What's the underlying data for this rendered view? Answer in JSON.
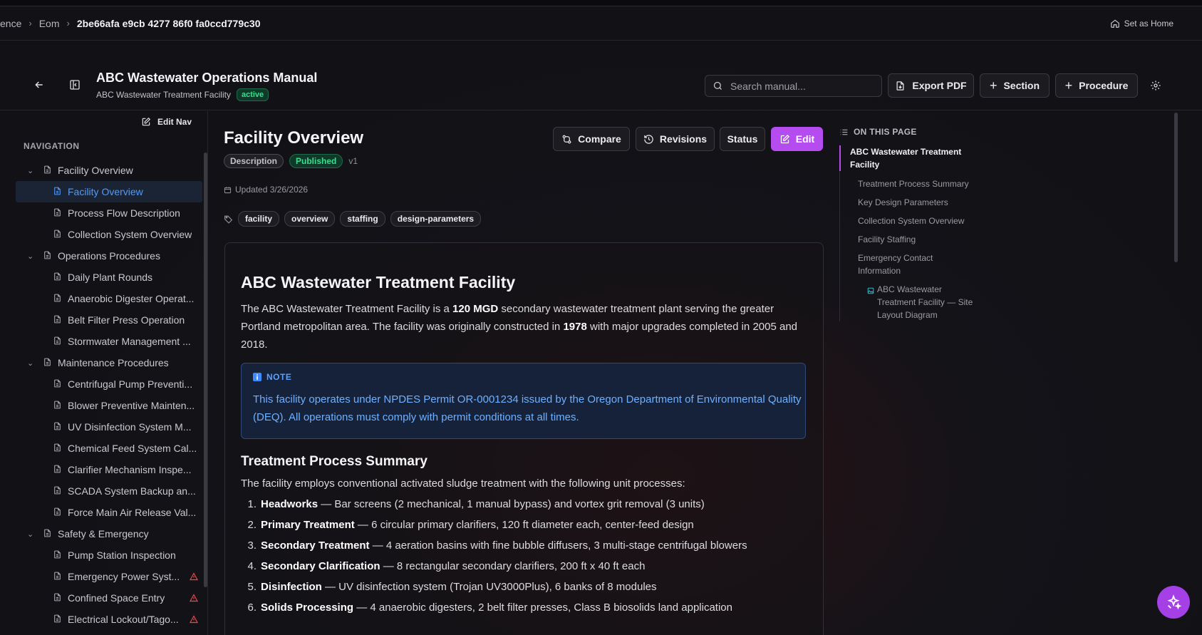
{
  "breadcrumb": {
    "items": [
      "ence",
      "Eom",
      "2be66afa e9cb 4277 86f0 fa0ccd779c30"
    ]
  },
  "header": {
    "set_home_label": "Set as Home",
    "title": "ABC Wastewater Operations Manual",
    "subtitle": "ABC Wastewater Treatment Facility",
    "status_badge": "active",
    "search_placeholder": "Search manual...",
    "export_label": "Export PDF",
    "section_label": "Section",
    "procedure_label": "Procedure"
  },
  "sidebar": {
    "edit_nav_label": "Edit Nav",
    "heading": "NAVIGATION",
    "groups": [
      {
        "label": "Facility Overview",
        "items": [
          {
            "label": "Facility Overview",
            "selected": true
          },
          {
            "label": "Process Flow Description"
          },
          {
            "label": "Collection System Overview"
          }
        ]
      },
      {
        "label": "Operations Procedures",
        "items": [
          {
            "label": "Daily Plant Rounds"
          },
          {
            "label": "Anaerobic Digester Operat..."
          },
          {
            "label": "Belt Filter Press Operation"
          },
          {
            "label": "Stormwater Management ..."
          }
        ]
      },
      {
        "label": "Maintenance Procedures",
        "items": [
          {
            "label": "Centrifugal Pump Preventi..."
          },
          {
            "label": "Blower Preventive Mainten..."
          },
          {
            "label": "UV Disinfection System M..."
          },
          {
            "label": "Chemical Feed System Cal..."
          },
          {
            "label": "Clarifier Mechanism Inspe..."
          },
          {
            "label": "SCADA System Backup an..."
          },
          {
            "label": "Force Main Air Release Val..."
          }
        ]
      },
      {
        "label": "Safety & Emergency",
        "items": [
          {
            "label": "Pump Station Inspection"
          },
          {
            "label": "Emergency Power Syst...",
            "warning": true
          },
          {
            "label": "Confined Space Entry",
            "warning": true
          },
          {
            "label": "Electrical Lockout/Tago...",
            "warning": true
          }
        ]
      }
    ]
  },
  "page": {
    "title": "Facility Overview",
    "type_pill": "Description",
    "status_pill": "Published",
    "version": "v1",
    "updated": "Updated 3/26/2026",
    "tags": [
      "facility",
      "overview",
      "staffing",
      "design-parameters"
    ],
    "actions": {
      "compare": "Compare",
      "revisions": "Revisions",
      "status": "Status",
      "edit": "Edit"
    }
  },
  "content": {
    "h1": "ABC Wastewater Treatment Facility",
    "para": {
      "t1": "The ABC Wastewater Treatment Facility is a ",
      "b1": "120 MGD",
      "t2": " secondary wastewater treatment plant serving the greater Portland metropolitan area. The facility was originally constructed in ",
      "b2": "1978",
      "t3": " with major upgrades completed in 2005 and 2018."
    },
    "note": {
      "label": "NOTE",
      "body": "This facility operates under NPDES Permit OR-0001234 issued by the Oregon Department of Environmental Quality (DEQ). All operations must comply with permit conditions at all times."
    },
    "h2": "Treatment Process Summary",
    "intro": "The facility employs conventional activated sludge treatment with the following unit processes:",
    "list": [
      {
        "num": "1.",
        "term": "Headworks",
        "desc": " — Bar screens (2 mechanical, 1 manual bypass) and vortex grit removal (3 units)"
      },
      {
        "num": "2.",
        "term": "Primary Treatment",
        "desc": " — 6 circular primary clarifiers, 120 ft diameter each, center-feed design"
      },
      {
        "num": "3.",
        "term": "Secondary Treatment",
        "desc": " — 4 aeration basins with fine bubble diffusers, 3 multi-stage centrifugal blowers"
      },
      {
        "num": "4.",
        "term": "Secondary Clarification",
        "desc": " — 8 rectangular secondary clarifiers, 200 ft x 40 ft each"
      },
      {
        "num": "5.",
        "term": "Disinfection",
        "desc": " — UV disinfection system (Trojan UV3000Plus), 6 banks of 8 modules"
      },
      {
        "num": "6.",
        "term": "Solids Processing",
        "desc": " — 4 anaerobic digesters, 2 belt filter presses, Class B biosolids land application"
      }
    ]
  },
  "toc": {
    "heading": "ON THIS PAGE",
    "items": [
      {
        "label": "ABC Wastewater Treatment Facility",
        "active": true
      },
      {
        "label": "Treatment Process Summary"
      },
      {
        "label": "Key Design Parameters"
      },
      {
        "label": "Collection System Overview"
      },
      {
        "label": "Facility Staffing"
      },
      {
        "label": "Emergency Contact Information"
      }
    ],
    "sub_item": "ABC Wastewater Treatment Facility — Site Layout Diagram"
  },
  "colors": {
    "accent": "#b44cf0",
    "published": "#3fdc8f",
    "note_text": "#6eb0ff",
    "selected_nav": "#4f9bff",
    "warning": "#e5484d"
  }
}
